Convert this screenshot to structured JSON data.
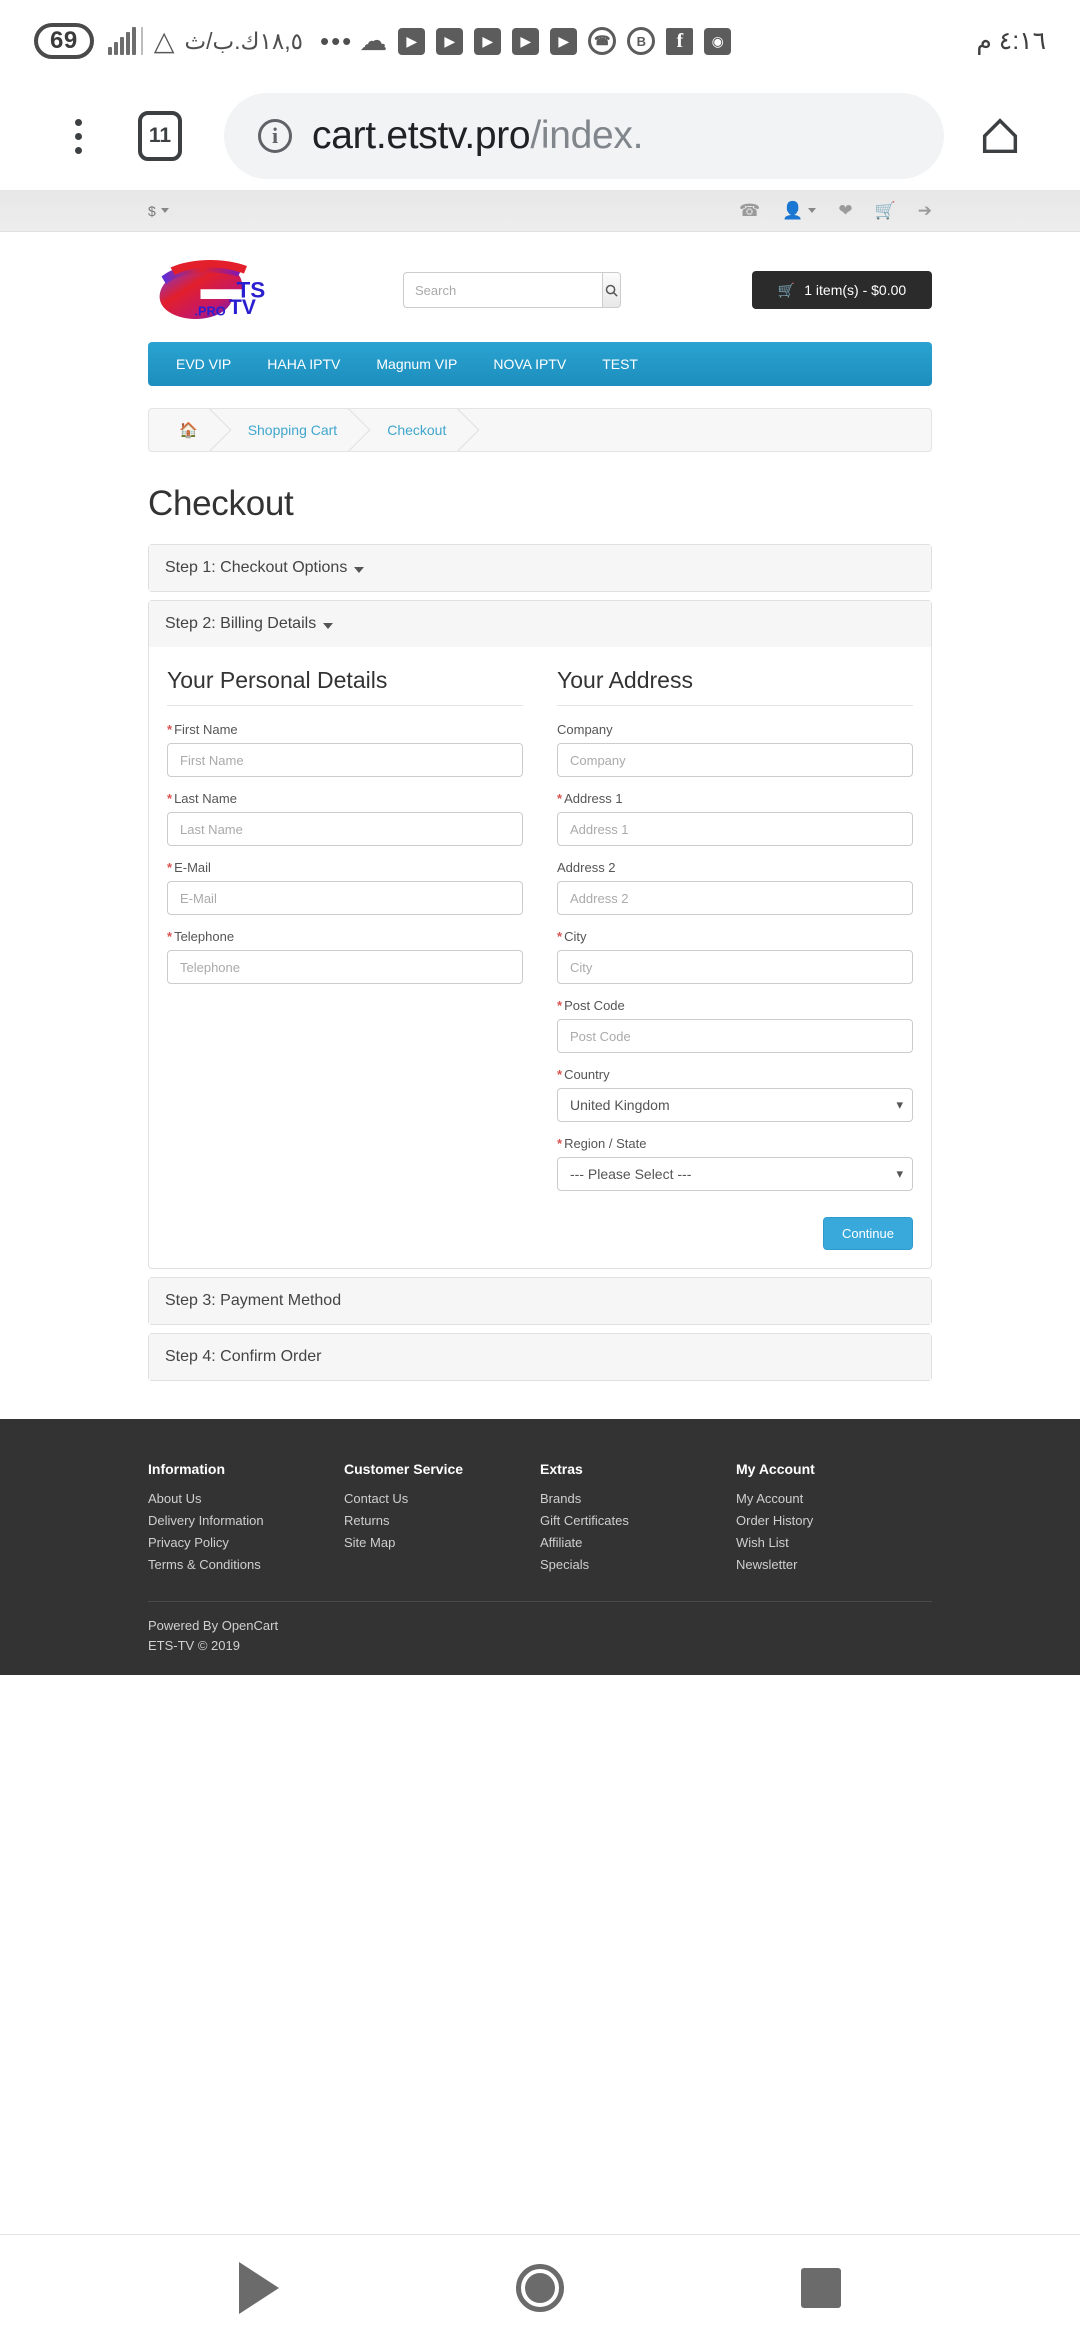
{
  "status_bar": {
    "battery": "69",
    "network_rate": "١٨,٥ك.ب/ث",
    "clock": "٤:١٦ م",
    "icons": [
      "signal-icon",
      "wifi-icon",
      "more-dots-icon",
      "cloud-icon",
      "youtube-icon",
      "youtube-icon",
      "youtube-icon",
      "youtube-icon",
      "youtube-icon",
      "call-icon",
      "b-circle-icon",
      "facebook-icon",
      "voicemail-icon"
    ]
  },
  "browser": {
    "tab_count": "11",
    "url_host": "cart.etstv.pro",
    "url_path": "/index."
  },
  "topbar": {
    "currency": "$",
    "icons": [
      "phone-icon",
      "user-icon",
      "wishlist-heart-icon",
      "cart-icon",
      "checkout-arrow-icon"
    ]
  },
  "header": {
    "logo_alt": "ETS TV .PRO",
    "search_placeholder": "Search",
    "search_value": "",
    "cart_label": "1 item(s) - $0.00"
  },
  "nav": {
    "items": [
      {
        "label": "EVD VIP"
      },
      {
        "label": "HAHA IPTV"
      },
      {
        "label": "Magnum VIP"
      },
      {
        "label": "NOVA IPTV"
      },
      {
        "label": "TEST"
      }
    ]
  },
  "breadcrumb": {
    "home_icon": "home-icon",
    "items": [
      {
        "label": "Shopping Cart"
      },
      {
        "label": "Checkout"
      }
    ]
  },
  "main": {
    "page_title": "Checkout",
    "step1_title": "Step 1: Checkout Options",
    "step2_title": "Step 2: Billing Details",
    "step3_title": "Step 3: Payment Method",
    "step4_title": "Step 4: Confirm Order",
    "personal": {
      "title": "Your Personal Details",
      "fields": [
        {
          "label": "First Name",
          "required": true,
          "placeholder": "First Name",
          "value": ""
        },
        {
          "label": "Last Name",
          "required": true,
          "placeholder": "Last Name",
          "value": ""
        },
        {
          "label": "E-Mail",
          "required": true,
          "placeholder": "E-Mail",
          "value": ""
        },
        {
          "label": "Telephone",
          "required": true,
          "placeholder": "Telephone",
          "value": ""
        }
      ]
    },
    "address": {
      "title": "Your Address",
      "fields": [
        {
          "label": "Company",
          "required": false,
          "placeholder": "Company",
          "value": ""
        },
        {
          "label": "Address 1",
          "required": true,
          "placeholder": "Address 1",
          "value": ""
        },
        {
          "label": "Address 2",
          "required": false,
          "placeholder": "Address 2",
          "value": ""
        },
        {
          "label": "City",
          "required": true,
          "placeholder": "City",
          "value": ""
        },
        {
          "label": "Post Code",
          "required": true,
          "placeholder": "Post Code",
          "value": ""
        }
      ],
      "country_label": "Country",
      "country_value": "United Kingdom",
      "region_label": "Region / State",
      "region_value": "--- Please Select ---"
    },
    "continue_label": "Continue"
  },
  "footer": {
    "columns": [
      {
        "title": "Information",
        "links": [
          "About Us",
          "Delivery Information",
          "Privacy Policy",
          "Terms & Conditions"
        ]
      },
      {
        "title": "Customer Service",
        "links": [
          "Contact Us",
          "Returns",
          "Site Map"
        ]
      },
      {
        "title": "Extras",
        "links": [
          "Brands",
          "Gift Certificates",
          "Affiliate",
          "Specials"
        ]
      },
      {
        "title": "My Account",
        "links": [
          "My Account",
          "Order History",
          "Wish List",
          "Newsletter"
        ]
      }
    ],
    "powered_prefix": "Powered By ",
    "powered_link": "OpenCart",
    "copyright": "ETS-TV © 2019"
  },
  "android_nav": {
    "back": "back-triangle-icon",
    "home": "home-circle-icon",
    "recents": "recents-square-icon"
  },
  "colors": {
    "nav_blue": "#1d8ebd",
    "link_blue": "#41a6cd",
    "button_blue": "#39a9dc",
    "footer_bg": "#333333",
    "required_red": "#d9534f"
  }
}
